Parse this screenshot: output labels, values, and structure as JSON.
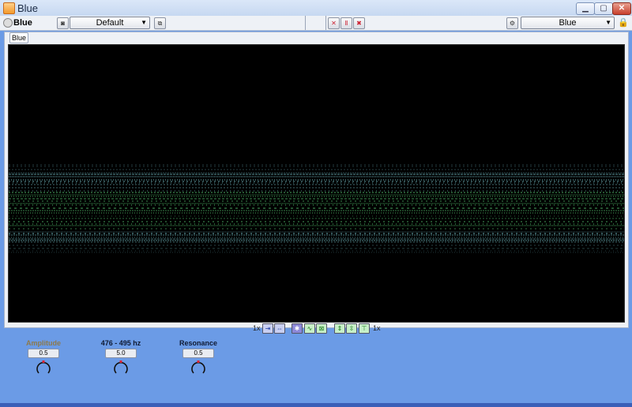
{
  "window": {
    "title": "Blue"
  },
  "toolbar": {
    "plugin_name": "Blue",
    "preset": "Default",
    "theme": "Blue"
  },
  "tab": {
    "label": "Blue"
  },
  "controls": {
    "zoom_left": "1x",
    "zoom_right": "1x"
  },
  "knobs": [
    {
      "label": "Amplitude",
      "value": "0.5",
      "level": 0.5,
      "dimmed": true
    },
    {
      "label": "476 - 495 hz",
      "value": "5.0",
      "level": 0.5,
      "dimmed": false
    },
    {
      "label": "Resonance",
      "value": "0.5",
      "level": 0.5,
      "dimmed": false
    }
  ],
  "colors": {
    "background": "#6b9be6",
    "spectrum_bg": "#000000",
    "trace_green": "#5cd67a",
    "trace_cyan": "#7fd0d8"
  }
}
